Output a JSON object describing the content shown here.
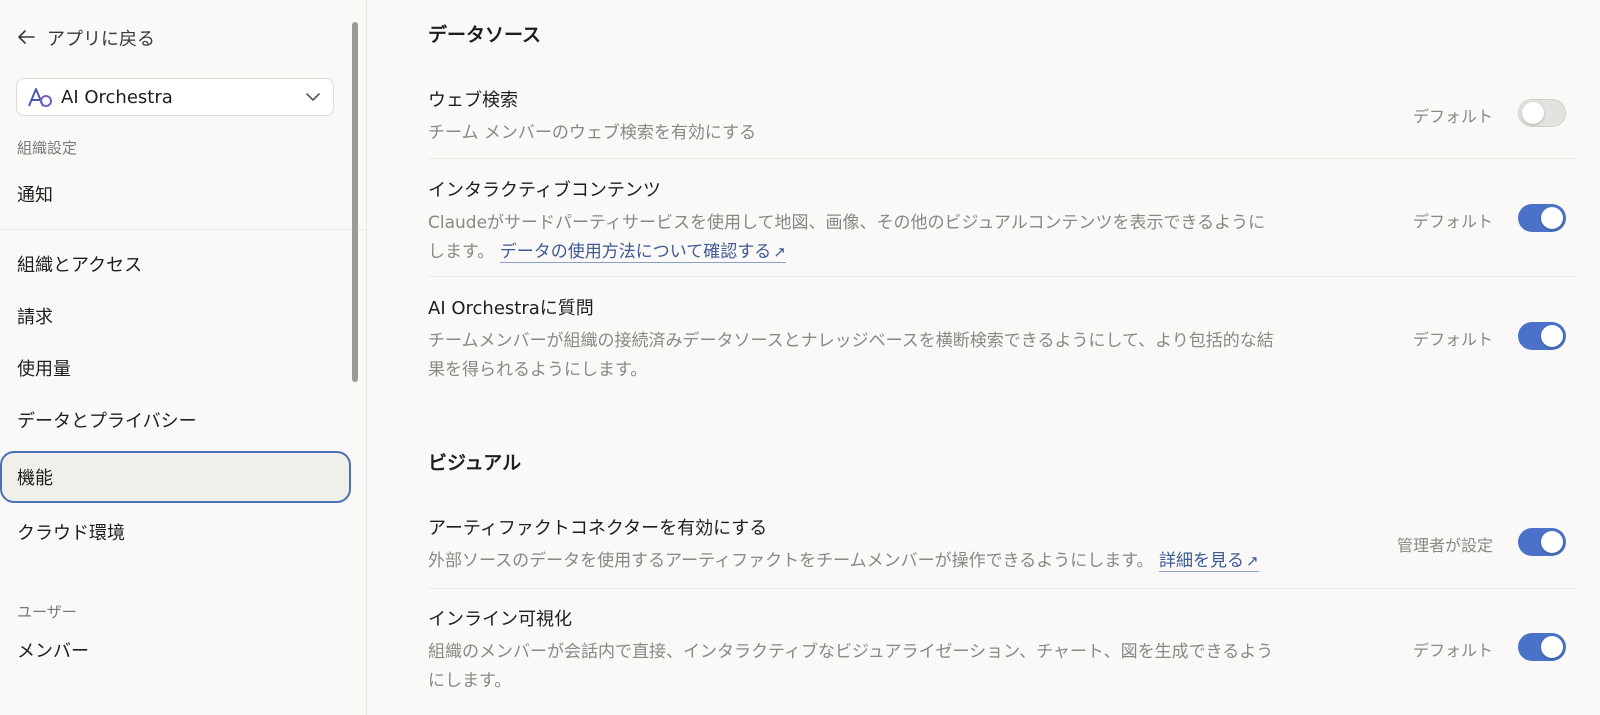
{
  "sidebar": {
    "back_label": "アプリに戻る",
    "org_name": "AI Orchestra",
    "section_org": "組織設定",
    "section_users": "ユーザー",
    "items": [
      {
        "label": "通知"
      },
      {
        "label": "組織とアクセス"
      },
      {
        "label": "請求"
      },
      {
        "label": "使用量"
      },
      {
        "label": "データとプライバシー"
      },
      {
        "label": "機能"
      },
      {
        "label": "クラウド環境"
      },
      {
        "label": "メンバー"
      }
    ],
    "active_item": "機能"
  },
  "main": {
    "sections": [
      {
        "title": "データソース",
        "rows": [
          {
            "title": "ウェブ検索",
            "description": "チーム メンバーのウェブ検索を有効にする",
            "state_label": "デフォルト",
            "enabled": false
          },
          {
            "title": "インタラクティブコンテンツ",
            "description_line1": "Claudeがサードパーティサービスを使用して地図、画像、その他のビジュアルコンテンツを表示できるように",
            "description_line2": "します。",
            "link": "データの使用方法について確認する",
            "state_label": "デフォルト",
            "enabled": true
          },
          {
            "title": "AI Orchestraに質問",
            "description_line1": "チームメンバーが組織の接続済みデータソースとナレッジベースを横断検索できるようにして、より包括的な結",
            "description_line2": "果を得られるようにします。",
            "state_label": "デフォルト",
            "enabled": true
          }
        ]
      },
      {
        "title": "ビジュアル",
        "rows": [
          {
            "title": "アーティファクトコネクターを有効にする",
            "description": "外部ソースのデータを使用するアーティファクトをチームメンバーが操作できるようにします。",
            "link": "詳細を見る",
            "state_label": "管理者が設定",
            "enabled": true
          },
          {
            "title": "インライン可視化",
            "description_line1": "組織のメンバーが会話内で直接、インタラクティブなビジュアライゼーション、チャート、図を生成できるよう",
            "description_line2": "にします。",
            "state_label": "デフォルト",
            "enabled": true
          }
        ]
      }
    ]
  },
  "colors": {
    "accent": "#4a72c8",
    "link": "#3d5a95",
    "active_border": "#4a6fb5"
  }
}
